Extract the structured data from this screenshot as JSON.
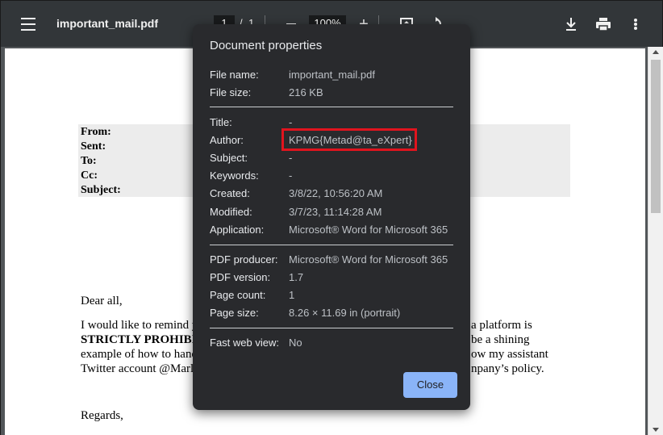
{
  "toolbar": {
    "file_name": "important_mail.pdf",
    "current_page": "1",
    "page_separator": "/",
    "total_pages": "1",
    "zoom": "100%",
    "zoom_in_symbol": "+",
    "icons": [
      "menu-icon",
      "zoom-out-icon",
      "zoom-in-icon",
      "fit-to-page-icon",
      "rotate-icon",
      "download-icon",
      "print-icon",
      "more-vert-icon"
    ]
  },
  "document": {
    "header_labels": [
      "From:",
      "Sent:",
      "To:",
      "Cc:",
      "Subject:"
    ],
    "lines": [
      "Dear all,",
      "I would like to remind y",
      "STRICTLY PROHIBI",
      "example of how to hand",
      "Twitter account @Marl",
      "a platform is",
      "be a shining",
      "ow my assistant",
      "npany’s policy.",
      "Regards,"
    ]
  },
  "dialog": {
    "title": "Document properties",
    "props": [
      {
        "label": "File name:",
        "value": "important_mail.pdf"
      },
      {
        "label": "File size:",
        "value": "216 KB"
      },
      {
        "label": "Title:",
        "value": "-"
      },
      {
        "label": "Author:",
        "value": "KPMG{Metad@ta_eXpert}"
      },
      {
        "label": "Subject:",
        "value": "-"
      },
      {
        "label": "Keywords:",
        "value": "-"
      },
      {
        "label": "Created:",
        "value": "3/8/22, 10:56:20 AM"
      },
      {
        "label": "Modified:",
        "value": "3/7/23, 11:14:28 AM"
      },
      {
        "label": "Application:",
        "value": "Microsoft® Word for Microsoft 365"
      },
      {
        "label": "PDF producer:",
        "value": "Microsoft® Word for Microsoft 365"
      },
      {
        "label": "PDF version:",
        "value": "1.7"
      },
      {
        "label": "Page count:",
        "value": "1"
      },
      {
        "label": "Page size:",
        "value": "8.26 × 11.69 in (portrait)"
      },
      {
        "label": "Fast web view:",
        "value": "No"
      }
    ],
    "close_label": "Close",
    "highlight_color": "#e0141e",
    "accent_color": "#8ab4f8"
  }
}
